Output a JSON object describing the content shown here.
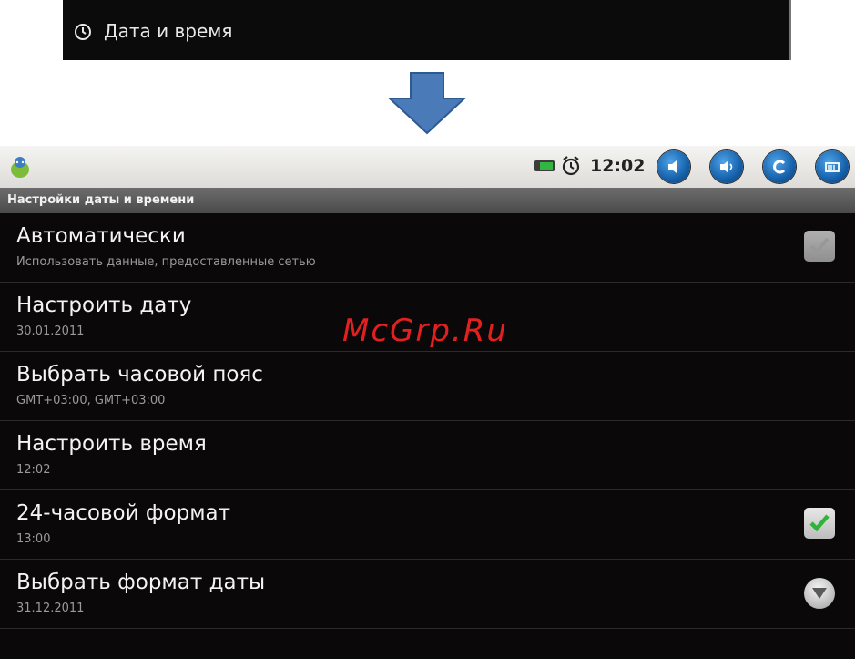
{
  "top_snippet": {
    "icon": "clock-icon",
    "label": "Дата и время"
  },
  "arrow": {
    "icon": "down-arrow",
    "color": "#4a7ab8"
  },
  "status_bar": {
    "time": "12:02",
    "icons": [
      "android-icon",
      "battery-icon",
      "alarm-clock-icon",
      "volume-down-icon",
      "volume-up-icon",
      "back-icon",
      "menu-icon"
    ]
  },
  "title_bar": {
    "title": "Настройки даты и времени"
  },
  "settings": [
    {
      "title": "Автоматически",
      "summary": "Использовать данные, предоставленные сетью",
      "control": "checkbox",
      "checked": true,
      "enabled": false
    },
    {
      "title": "Настроить дату",
      "summary": "30.01.2011"
    },
    {
      "title": "Выбрать часовой пояс",
      "summary": "GMT+03:00, GMT+03:00"
    },
    {
      "title": "Настроить время",
      "summary": "12:02"
    },
    {
      "title": "24-часовой формат",
      "summary": "13:00",
      "control": "checkbox",
      "checked": true,
      "enabled": true
    },
    {
      "title": "Выбрать формат даты",
      "summary": "31.12.2011",
      "control": "dropdown"
    }
  ],
  "watermark": "McGrp.Ru",
  "colors": {
    "accent_check": "#2fb43a",
    "button_blue": "#1560aa",
    "watermark": "#e32020"
  }
}
